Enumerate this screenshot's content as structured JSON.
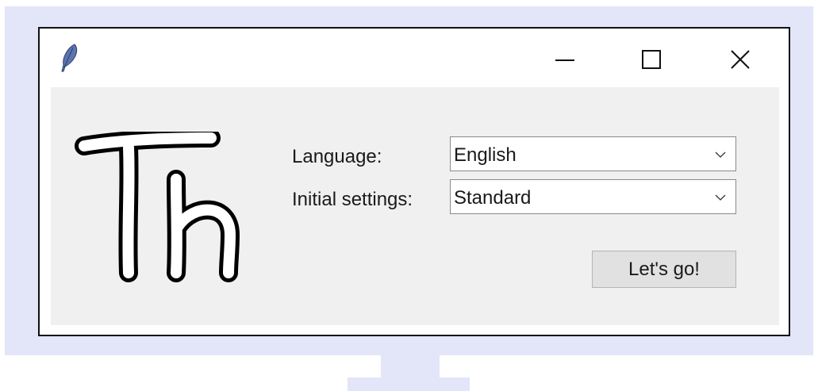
{
  "window": {
    "icon": "feather-icon",
    "controls": {
      "minimize": "minimize-icon",
      "maximize": "maximize-icon",
      "close": "close-icon"
    }
  },
  "logo": {
    "text": "Th"
  },
  "form": {
    "language": {
      "label": "Language:",
      "value": "English"
    },
    "initial_settings": {
      "label": "Initial settings:",
      "value": "Standard"
    },
    "submit_label": "Let's go!"
  },
  "colors": {
    "monitor": "#e3e5f8",
    "client_background": "#f0f0f0",
    "feather": "#5b75b0"
  }
}
